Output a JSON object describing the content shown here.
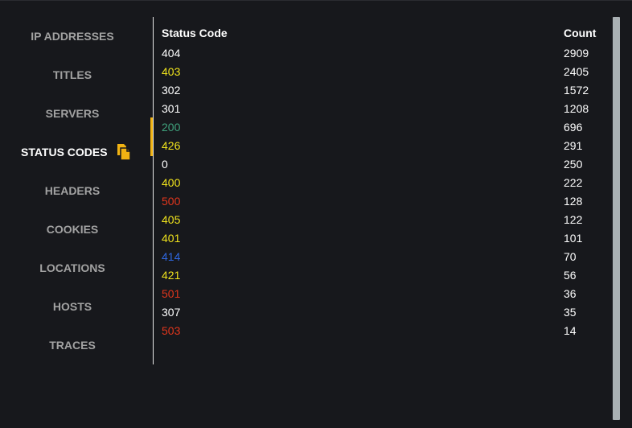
{
  "sidebar": {
    "items": [
      {
        "label": "IP ADDRESSES"
      },
      {
        "label": "TITLES"
      },
      {
        "label": "SERVERS"
      },
      {
        "label": "STATUS CODES",
        "active": true
      },
      {
        "label": "HEADERS"
      },
      {
        "label": "COOKIES"
      },
      {
        "label": "LOCATIONS"
      },
      {
        "label": "HOSTS"
      },
      {
        "label": "TRACES"
      }
    ],
    "copy_icon": "copy-icon",
    "accent_color": "#f1b313"
  },
  "table": {
    "headers": {
      "code": "Status Code",
      "count": "Count"
    },
    "rows": [
      {
        "code": "404",
        "count": "2909",
        "color": "#ffffff"
      },
      {
        "code": "403",
        "count": "2405",
        "color": "#f0e31c"
      },
      {
        "code": "302",
        "count": "1572",
        "color": "#ffffff"
      },
      {
        "code": "301",
        "count": "1208",
        "color": "#ffffff"
      },
      {
        "code": "200",
        "count": "696",
        "color": "#3fa17c"
      },
      {
        "code": "426",
        "count": "291",
        "color": "#f0e31c"
      },
      {
        "code": "0",
        "count": "250",
        "color": "#ffffff"
      },
      {
        "code": "400",
        "count": "222",
        "color": "#f0e31c"
      },
      {
        "code": "500",
        "count": "128",
        "color": "#e0361c"
      },
      {
        "code": "405",
        "count": "122",
        "color": "#f0e31c"
      },
      {
        "code": "401",
        "count": "101",
        "color": "#f0e31c"
      },
      {
        "code": "414",
        "count": "70",
        "color": "#2f67e0"
      },
      {
        "code": "421",
        "count": "56",
        "color": "#f0e31c"
      },
      {
        "code": "501",
        "count": "36",
        "color": "#e0361c"
      },
      {
        "code": "307",
        "count": "35",
        "color": "#ffffff"
      },
      {
        "code": "503",
        "count": "14",
        "color": "#e0361c"
      }
    ]
  }
}
